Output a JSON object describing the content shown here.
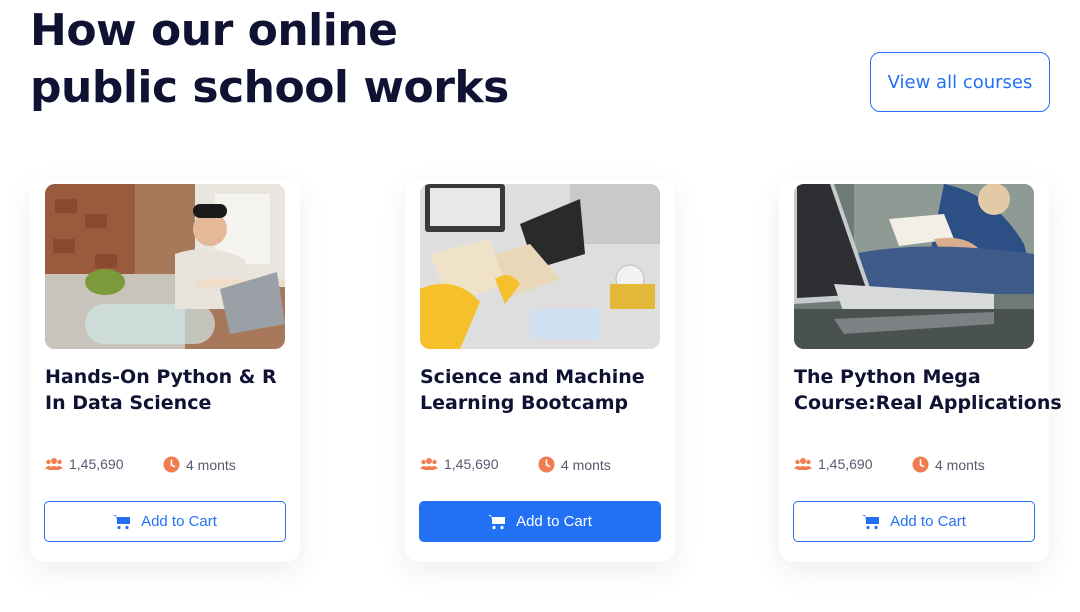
{
  "header": {
    "title_line1": "How our online",
    "title_line2": "public school works",
    "view_all_label": "View all courses"
  },
  "colors": {
    "accent": "#2271f5",
    "meta_icon": "#f07c4f",
    "heading": "#0f1233"
  },
  "courses": [
    {
      "title_line1": "Hands-On Python & R",
      "title_line2": "In Data Science",
      "students": "1,45,690",
      "duration": "4 monts",
      "cart_label": "Add to Cart",
      "image": "student-with-laptop-photo"
    },
    {
      "title_line1": "Science and Machine",
      "title_line2": "Learning Bootcamp",
      "students": "1,45,690",
      "duration": "4 monts",
      "cart_label": "Add to Cart",
      "image": "desk-with-books-photo"
    },
    {
      "title_line1": "The Python Mega",
      "title_line2": "Course:Real Applications",
      "students": "1,45,690",
      "duration": "4 monts",
      "cart_label": "Add to Cart",
      "image": "person-reading-with-laptop-photo"
    }
  ]
}
